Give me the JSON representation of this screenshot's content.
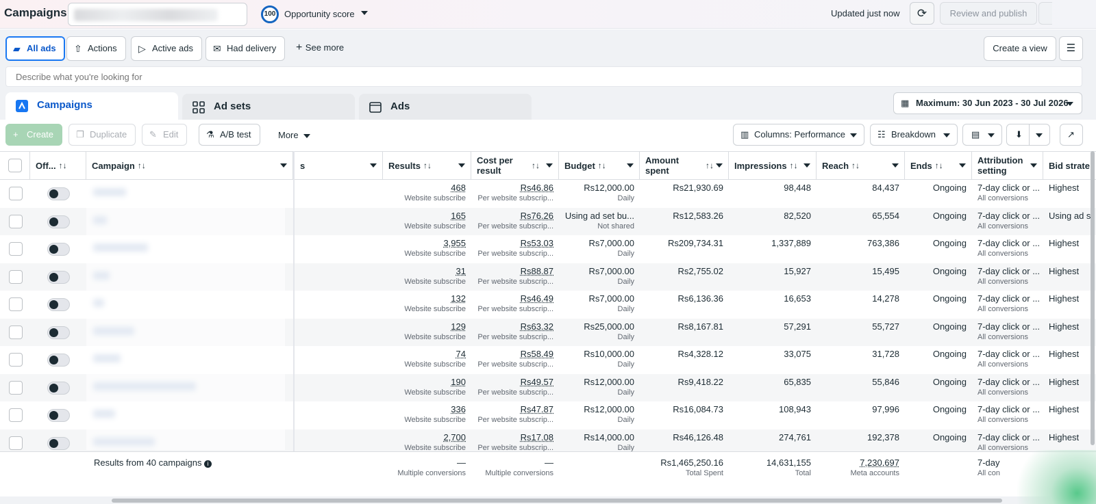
{
  "topbar": {
    "title": "Campaigns",
    "opportunity_score": "100",
    "opportunity_label": "Opportunity score",
    "updated": "Updated just now",
    "review_publish": "Review and publish"
  },
  "filters": {
    "all_ads": "All ads",
    "actions": "Actions",
    "active_ads": "Active ads",
    "had_delivery": "Had delivery",
    "see_more": "See more",
    "create_view": "Create a view"
  },
  "search": {
    "placeholder": "Describe what you're looking for"
  },
  "tabs": {
    "campaigns": "Campaigns",
    "ad_sets": "Ad sets",
    "ads": "Ads"
  },
  "date_range": "Maximum: 30 Jun 2023 - 30 Jul 2026",
  "toolbar": {
    "create": "Create",
    "duplicate": "Duplicate",
    "edit": "Edit",
    "ab_test": "A/B test",
    "more": "More",
    "columns": "Columns: Performance",
    "breakdown": "Breakdown"
  },
  "headers": {
    "off": "Off...",
    "campaign": "Campaign",
    "delivery": "s",
    "results": "Results",
    "cost_per_result": "Cost per result",
    "budget": "Budget",
    "amount_spent": "Amount spent",
    "impressions": "Impressions",
    "reach": "Reach",
    "ends": "Ends",
    "attribution": "Attribution setting",
    "bid_strategy": "Bid strate"
  },
  "rows": [
    {
      "results": "468",
      "results_sub": "Website subscribe",
      "cpr": "Rs46.86",
      "cpr_sub": "Per website subscrip...",
      "budget": "Rs12,000.00",
      "budget_sub": "Daily",
      "spent": "Rs21,930.69",
      "impressions": "98,448",
      "reach": "84,437",
      "ends": "Ongoing",
      "attr": "7-day click or ...",
      "attr_sub": "All conversions",
      "bid": "Highest"
    },
    {
      "results": "165",
      "results_sub": "Website subscribe",
      "cpr": "Rs76.26",
      "cpr_sub": "Per website subscrip...",
      "budget": "Using ad set bu...",
      "budget_sub": "Not shared",
      "spent": "Rs12,583.26",
      "impressions": "82,520",
      "reach": "65,554",
      "ends": "Ongoing",
      "attr": "7-day click or ...",
      "attr_sub": "All conversions",
      "bid": "Using ad s"
    },
    {
      "results": "3,955",
      "results_sub": "Website subscribe",
      "cpr": "Rs53.03",
      "cpr_sub": "Per website subscrip...",
      "budget": "Rs7,000.00",
      "budget_sub": "Daily",
      "spent": "Rs209,734.31",
      "impressions": "1,337,889",
      "reach": "763,386",
      "ends": "Ongoing",
      "attr": "7-day click or ...",
      "attr_sub": "All conversions",
      "bid": "Highest"
    },
    {
      "results": "31",
      "results_sub": "Website subscribe",
      "cpr": "Rs88.87",
      "cpr_sub": "Per website subscrip...",
      "budget": "Rs7,000.00",
      "budget_sub": "Daily",
      "spent": "Rs2,755.02",
      "impressions": "15,927",
      "reach": "15,495",
      "ends": "Ongoing",
      "attr": "7-day click or ...",
      "attr_sub": "All conversions",
      "bid": "Highest"
    },
    {
      "results": "132",
      "results_sub": "Website subscribe",
      "cpr": "Rs46.49",
      "cpr_sub": "Per website subscrip...",
      "budget": "Rs7,000.00",
      "budget_sub": "Daily",
      "spent": "Rs6,136.36",
      "impressions": "16,653",
      "reach": "14,278",
      "ends": "Ongoing",
      "attr": "7-day click or ...",
      "attr_sub": "All conversions",
      "bid": "Highest"
    },
    {
      "results": "129",
      "results_sub": "Website subscribe",
      "cpr": "Rs63.32",
      "cpr_sub": "Per website subscrip...",
      "budget": "Rs25,000.00",
      "budget_sub": "Daily",
      "spent": "Rs8,167.81",
      "impressions": "57,291",
      "reach": "55,727",
      "ends": "Ongoing",
      "attr": "7-day click or ...",
      "attr_sub": "All conversions",
      "bid": "Highest"
    },
    {
      "results": "74",
      "results_sub": "Website subscribe",
      "cpr": "Rs58.49",
      "cpr_sub": "Per website subscrip...",
      "budget": "Rs10,000.00",
      "budget_sub": "Daily",
      "spent": "Rs4,328.12",
      "impressions": "33,075",
      "reach": "31,728",
      "ends": "Ongoing",
      "attr": "7-day click or ...",
      "attr_sub": "All conversions",
      "bid": "Highest"
    },
    {
      "results": "190",
      "results_sub": "Website subscribe",
      "cpr": "Rs49.57",
      "cpr_sub": "Per website subscrip...",
      "budget": "Rs12,000.00",
      "budget_sub": "Daily",
      "spent": "Rs9,418.22",
      "impressions": "65,835",
      "reach": "55,846",
      "ends": "Ongoing",
      "attr": "7-day click or ...",
      "attr_sub": "All conversions",
      "bid": "Highest"
    },
    {
      "results": "336",
      "results_sub": "Website subscribe",
      "cpr": "Rs47.87",
      "cpr_sub": "Per website subscrip...",
      "budget": "Rs12,000.00",
      "budget_sub": "Daily",
      "spent": "Rs16,084.73",
      "impressions": "108,943",
      "reach": "97,996",
      "ends": "Ongoing",
      "attr": "7-day click or ...",
      "attr_sub": "All conversions",
      "bid": "Highest"
    },
    {
      "results": "2,700",
      "results_sub": "Website subscribe",
      "cpr": "Rs17.08",
      "cpr_sub": "Per website subscrip...",
      "budget": "Rs14,000.00",
      "budget_sub": "Daily",
      "spent": "Rs46,126.48",
      "impressions": "274,761",
      "reach": "192,378",
      "ends": "Ongoing",
      "attr": "7-day click or ...",
      "attr_sub": "All conversions",
      "bid": "Highest"
    }
  ],
  "summary": {
    "label": "Results from 40 campaigns",
    "results": "—",
    "results_sub": "Multiple conversions",
    "cpr": "—",
    "cpr_sub": "Multiple conversions",
    "spent": "Rs1,465,250.16",
    "spent_sub": "Total Spent",
    "impressions": "14,631,155",
    "impressions_sub": "Total",
    "reach": "7,230,697",
    "reach_sub": "Meta accounts",
    "attr": "7-day",
    "attr_sub": "All con"
  }
}
